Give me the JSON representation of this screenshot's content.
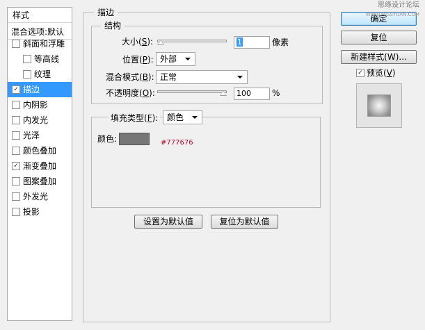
{
  "left_panel": {
    "header": "样式",
    "blend_options": "混合选项:默认",
    "items": [
      {
        "label": "斜面和浮雕",
        "checked": false
      },
      {
        "label": "等高线",
        "checked": false
      },
      {
        "label": "纹理",
        "checked": false
      },
      {
        "label": "描边",
        "checked": true,
        "selected": true
      },
      {
        "label": "内阴影",
        "checked": false
      },
      {
        "label": "内发光",
        "checked": false
      },
      {
        "label": "光泽",
        "checked": false
      },
      {
        "label": "颜色叠加",
        "checked": false
      },
      {
        "label": "渐变叠加",
        "checked": true
      },
      {
        "label": "图案叠加",
        "checked": false
      },
      {
        "label": "外发光",
        "checked": false
      },
      {
        "label": "投影",
        "checked": false
      }
    ]
  },
  "stroke": {
    "title": "描边",
    "structure_title": "结构",
    "size": {
      "label_pre": "大小(",
      "key": "S",
      "label_post": "):",
      "value": "1",
      "unit": "像素",
      "slider_fraction": 0.0
    },
    "position": {
      "label_pre": "位置(",
      "key": "P",
      "label_post": "):",
      "value": "外部"
    },
    "blend_mode": {
      "label_pre": "混合模式(",
      "key": "B",
      "label_post": "):",
      "value": "正常"
    },
    "opacity": {
      "label_pre": "不透明度(",
      "key": "O",
      "label_post": "):",
      "value": "100",
      "unit": "%",
      "slider_fraction": 1.0
    },
    "fill_type": {
      "label_pre": "填充类型(",
      "key": "F",
      "label_post": "):",
      "value": "颜色"
    },
    "color": {
      "label": "颜色:",
      "hex": "#777676",
      "annotation": "#777676"
    }
  },
  "buttons": {
    "set_default": "设置为默认值",
    "reset_default": "复位为默认值",
    "ok": "确定",
    "reset": "复位",
    "new_style": "新建样式(W)...",
    "preview_label_pre": "预览(",
    "preview_key": "V",
    "preview_label_post": ")",
    "preview_checked": true
  },
  "watermark": {
    "line1": "思缘设计论坛",
    "line2": "WWW.MISSYUAN.COM"
  },
  "colors": {
    "selection_blue": "#3399ff",
    "annotation_red": "#c0002b",
    "swatch": "#777676"
  }
}
